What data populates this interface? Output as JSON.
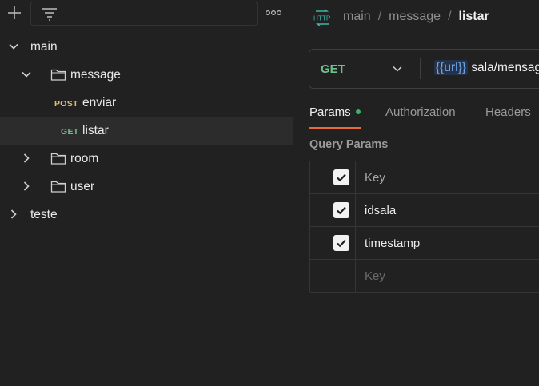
{
  "sidebar": {
    "tree": [
      {
        "label": "main",
        "expanded": true
      },
      {
        "label": "message",
        "expanded": true
      },
      {
        "method": "POST",
        "label": "enviar"
      },
      {
        "method": "GET",
        "label": "listar",
        "selected": true
      },
      {
        "label": "room",
        "expanded": false
      },
      {
        "label": "user",
        "expanded": false
      },
      {
        "label": "teste",
        "expanded": false
      }
    ]
  },
  "breadcrumb": {
    "icon": "http-icon",
    "items": [
      "main",
      "message",
      "listar"
    ],
    "separator": "/"
  },
  "request": {
    "method": "GET",
    "url_variable": "{{url}}",
    "url_rest": "sala/mensag"
  },
  "tabs": [
    {
      "label": "Params",
      "active": true,
      "indicator_dot": true
    },
    {
      "label": "Authorization"
    },
    {
      "label": "Headers"
    }
  ],
  "query_params": {
    "title": "Query Params",
    "header": {
      "checked": true,
      "key": "Key"
    },
    "rows": [
      {
        "checked": true,
        "key": "idsala"
      },
      {
        "checked": true,
        "key": "timestamp"
      }
    ],
    "empty_row": {
      "key_placeholder": "Key"
    }
  },
  "colors": {
    "background": "#212121",
    "get_method": "#6cc28c",
    "post_method": "#e5c06a",
    "active_tab_underline": "#e86a3a",
    "status_dot": "#3bb16b",
    "url_variable": "#6ea7e8"
  }
}
